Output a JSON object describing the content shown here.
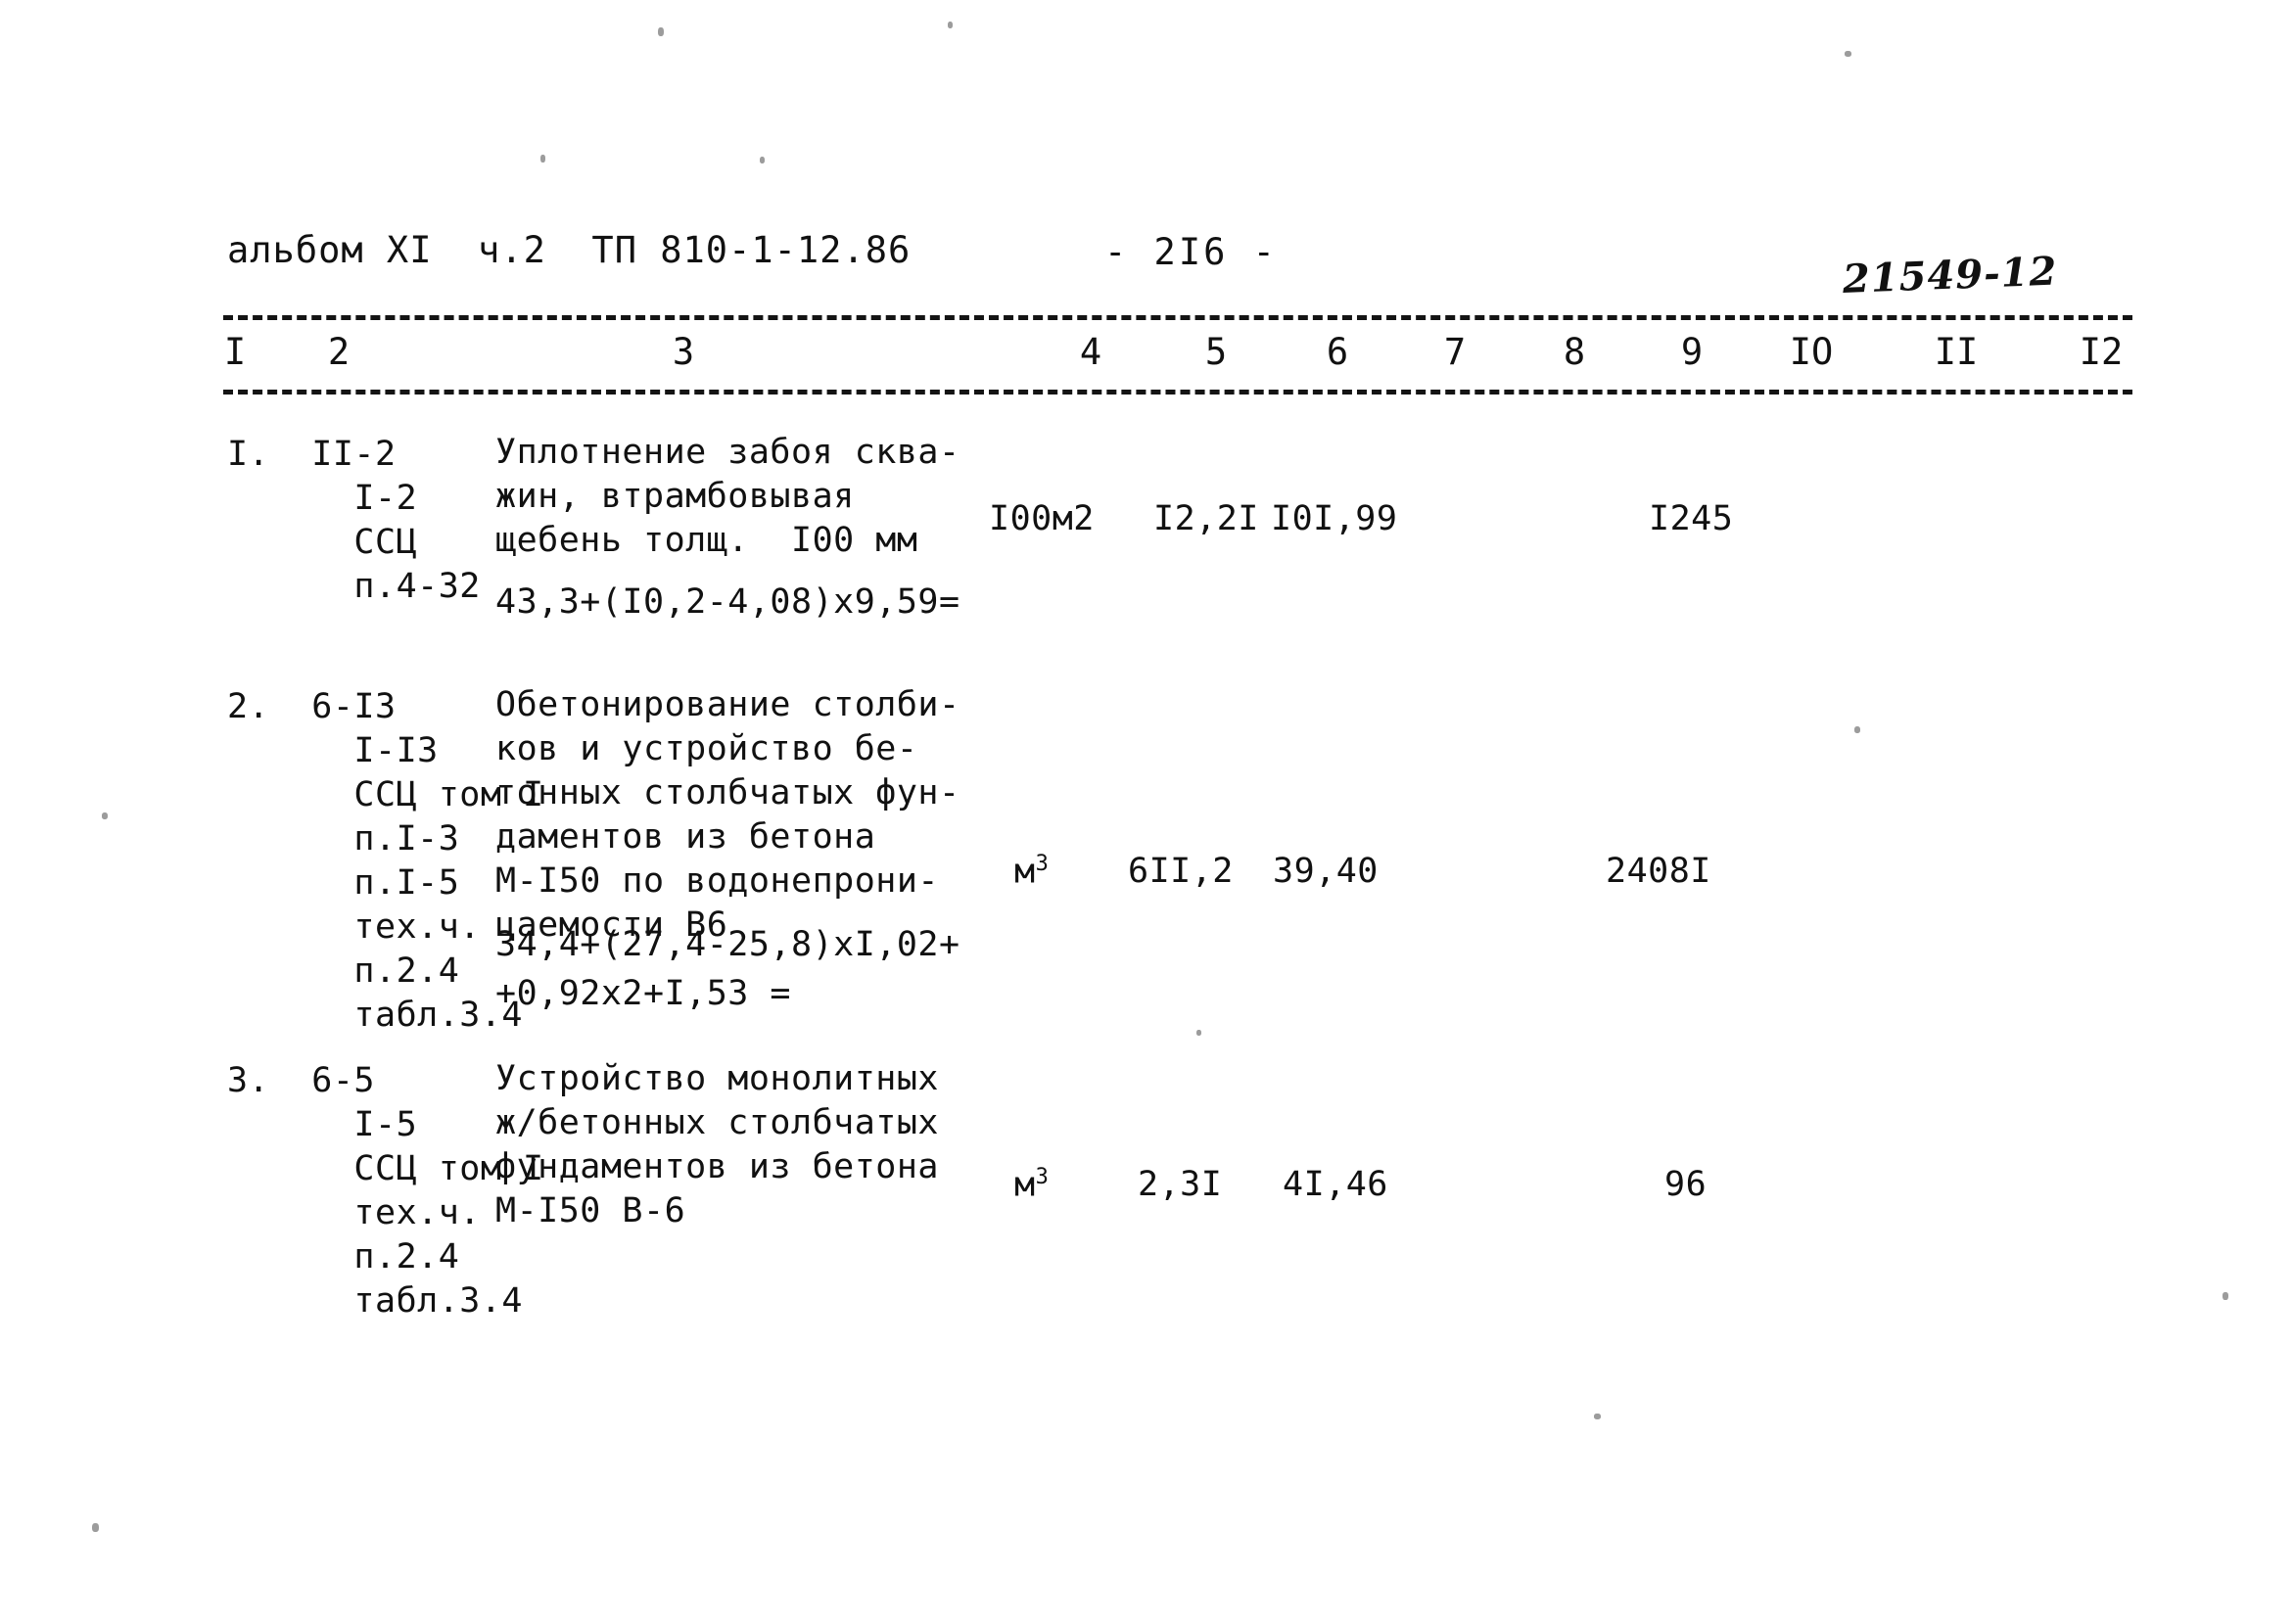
{
  "header": {
    "album_ref": "альбом XI  ч.2  ТП 810-1-12.86",
    "page_number": "- 2I6 -",
    "archive_number": "21549-12"
  },
  "table": {
    "column_numbers": [
      "I",
      "2",
      "3",
      "4",
      "5",
      "6",
      "7",
      "8",
      "9",
      "IO",
      "II",
      "I2"
    ],
    "rows": [
      {
        "index": "I.",
        "codes": "I.  II-2\n      I-2\n      ССЦ\n      п.4-32",
        "description": "Уплотнение забоя сква-\nжин, втрамбовывая\nщебень толщ.  I00 мм",
        "formula": "43,3+(I0,2-4,08)x9,59=",
        "unit": "I00м2",
        "quantity": "I2,2I",
        "unit_price": "I0I,99",
        "total": "I245"
      },
      {
        "index": "2.",
        "codes": "2.  6-I3\n      I-I3\n      ССЦ том I\n      п.I-3\n      п.I-5\n      тех.ч.\n      п.2.4\n      табл.3.4",
        "description": "Обетонирование столби-\nков и устройство бе-\nтонных столбчатых фун-\nдаментов из бетона\nМ-I50 по водонепрони-\nцаемости В6",
        "formula": "34,4+(27,4-25,8)xI,02+\n+0,92x2+I,53 =",
        "unit": "м",
        "unit_exp": "3",
        "quantity": "6II,2",
        "unit_price": "39,40",
        "total": "2408I"
      },
      {
        "index": "3.",
        "codes": "3.  6-5\n      I-5\n      ССЦ том I\n      тех.ч.\n      п.2.4\n      табл.3.4",
        "description": "Устройство монолитных\nж/бетонных столбчатых\nфундаментов из бетона\nМ-I50 В-6",
        "formula": "",
        "unit": "м",
        "unit_exp": "3",
        "quantity": "2,3I",
        "unit_price": "4I,46",
        "total": "96"
      }
    ]
  }
}
